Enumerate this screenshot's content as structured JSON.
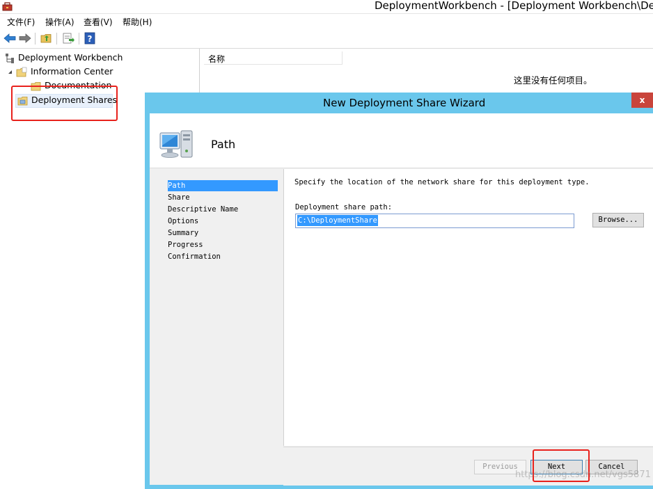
{
  "window": {
    "title": "DeploymentWorkbench - [Deployment Workbench\\Dep"
  },
  "menu": {
    "items": [
      "文件(F)",
      "操作(A)",
      "查看(V)",
      "帮助(H)"
    ]
  },
  "toolbar": {
    "icons": [
      "back-arrow-icon",
      "forward-arrow-icon",
      "folder-up-icon",
      "export-list-icon",
      "help-icon"
    ]
  },
  "tree": {
    "root": "Deployment Workbench",
    "information_center": "Information Center",
    "documentation": "Documentation",
    "deployment_shares": "Deployment Shares"
  },
  "list": {
    "column_name": "名称",
    "empty_message": "这里没有任何项目。"
  },
  "dialog": {
    "title": "New Deployment Share Wizard",
    "close_glyph": "x",
    "header_title": "Path",
    "steps": [
      "Path",
      "Share",
      "Descriptive Name",
      "Options",
      "Summary",
      "Progress",
      "Confirmation"
    ],
    "active_step": "Path",
    "instruction": "Specify the location of the network share for this deployment type.",
    "path_label": "Deployment share path:",
    "path_value": "C:\\DeploymentShare",
    "browse_label": "Browse...",
    "previous_label": "Previous",
    "next_label": "Next",
    "cancel_label": "Cancel"
  },
  "watermark": "https://blog.csdn.net/vgs5871",
  "colors": {
    "dialog_frame": "#6ac7ec",
    "selection": "#3399ff",
    "annotation": "#e8211c",
    "close_button": "#c9443b"
  }
}
